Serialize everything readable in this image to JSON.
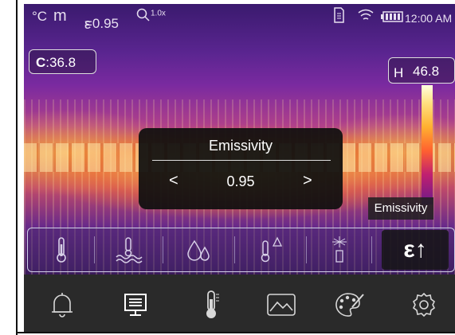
{
  "status_bar": {
    "unit": "°C",
    "mode_symbol": "m",
    "emissivity_symbol": "ε",
    "emissivity": "=0.95",
    "zoom": "1.0x",
    "time": "12:00 AM",
    "icons": [
      "sd-card-icon",
      "wifi-icon",
      "battery-icon"
    ]
  },
  "center_temp": {
    "prefix": "C",
    "value": ":36.8"
  },
  "high_temp": {
    "label": "H",
    "value": "46.8"
  },
  "tooltip": "Emissivity",
  "emissivity_dialog": {
    "title": "Emissivity",
    "prev": "<",
    "value": "0.95",
    "next": ">"
  },
  "mode_strip": {
    "items": [
      "thermometer-icon",
      "heat-wave-icon",
      "droplets-icon",
      "thermometer-delta-icon",
      "laser-icon",
      "emissivity-icon"
    ],
    "active_label": "ε↑"
  },
  "toolbar": {
    "items": [
      "bell-icon",
      "display-icon",
      "thermometer-icon",
      "image-icon",
      "palette-icon",
      "settings-icon"
    ]
  },
  "colors": {
    "dialog_bg": "#0f0f0f",
    "toolbar_bg": "#2a2a2a",
    "accent_text": "#ffffff"
  }
}
